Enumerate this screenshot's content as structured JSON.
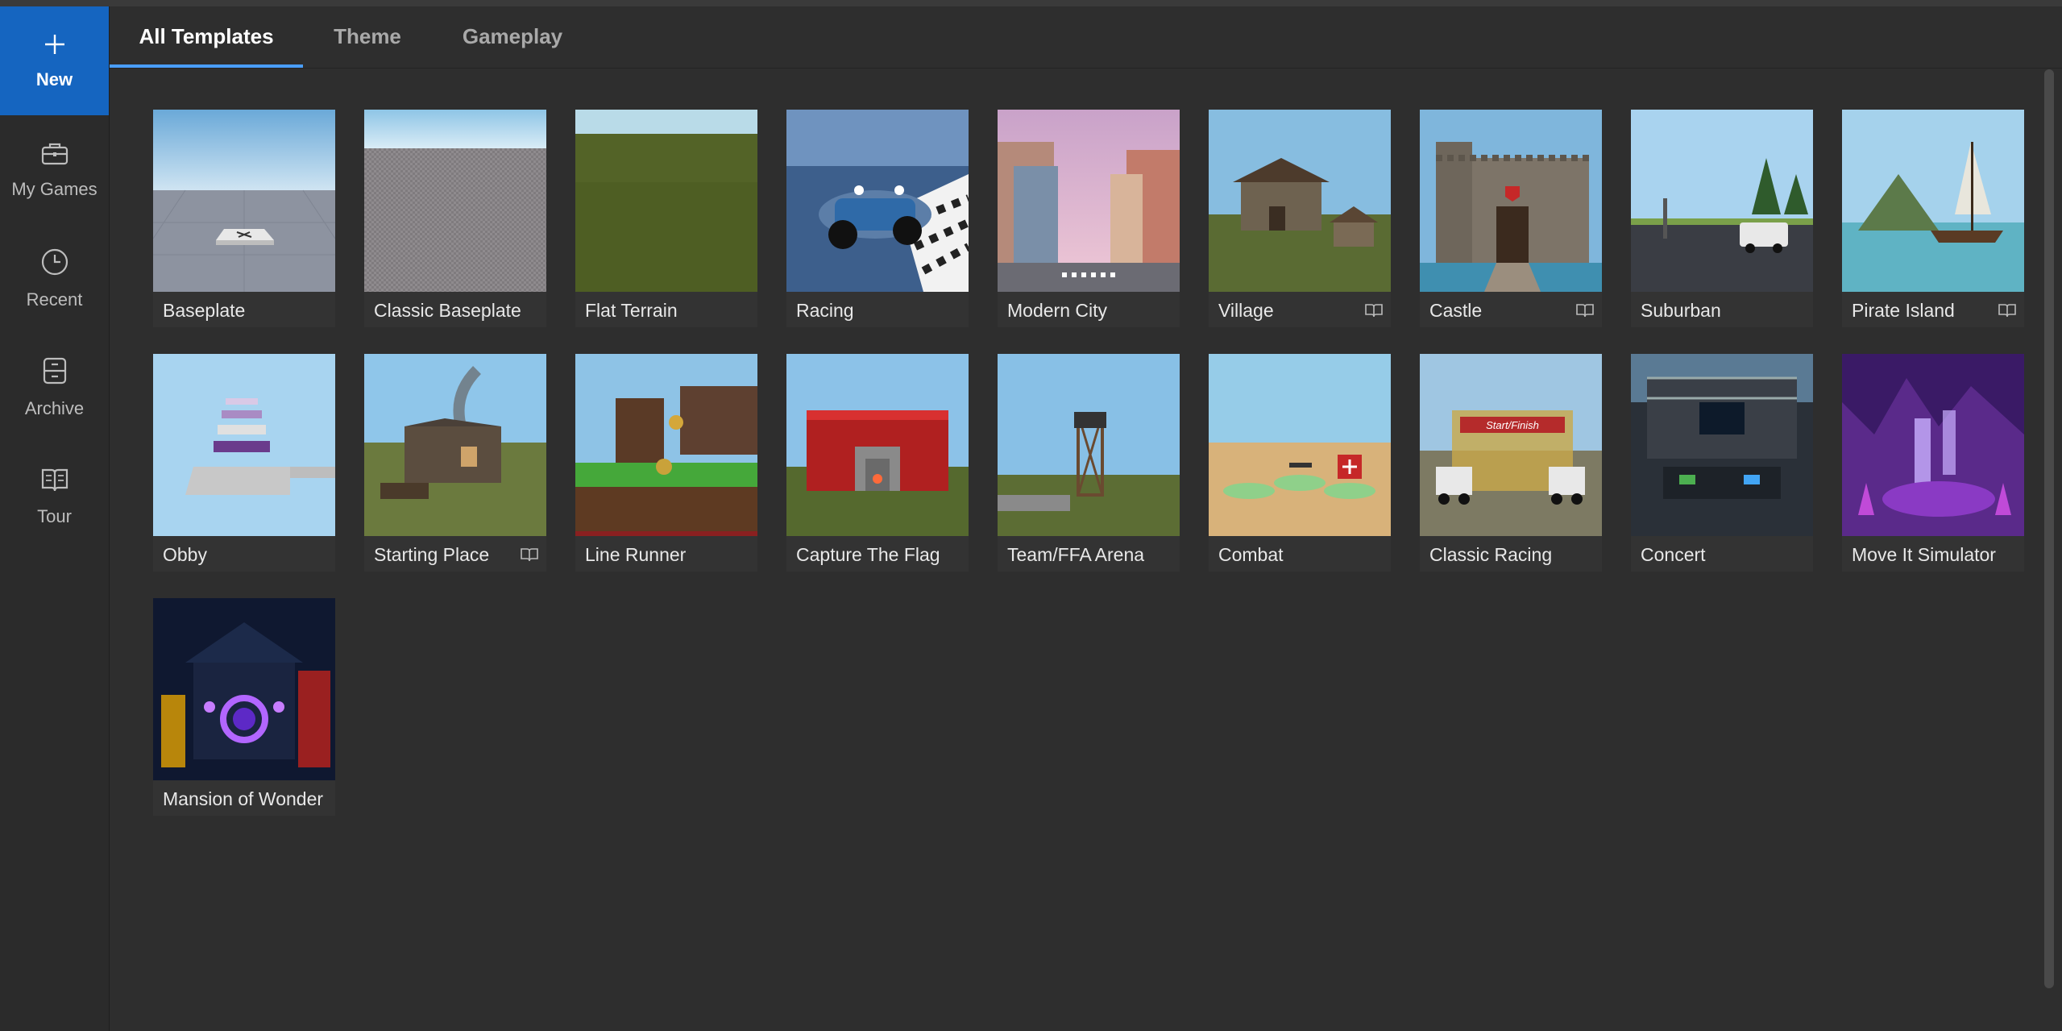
{
  "sidebar": {
    "items": [
      {
        "label": "New",
        "icon": "plus-icon",
        "active": true
      },
      {
        "label": "My Games",
        "icon": "briefcase-icon",
        "active": false
      },
      {
        "label": "Recent",
        "icon": "clock-icon",
        "active": false
      },
      {
        "label": "Archive",
        "icon": "archive-icon",
        "active": false
      },
      {
        "label": "Tour",
        "icon": "book-icon",
        "active": false
      }
    ]
  },
  "tabs": [
    {
      "label": "All Templates",
      "active": true
    },
    {
      "label": "Theme",
      "active": false
    },
    {
      "label": "Gameplay",
      "active": false
    }
  ],
  "templates": [
    {
      "name": "Baseplate",
      "tutorial": false
    },
    {
      "name": "Classic Baseplate",
      "tutorial": false
    },
    {
      "name": "Flat Terrain",
      "tutorial": false
    },
    {
      "name": "Racing",
      "tutorial": false
    },
    {
      "name": "Modern City",
      "tutorial": false
    },
    {
      "name": "Village",
      "tutorial": true
    },
    {
      "name": "Castle",
      "tutorial": true
    },
    {
      "name": "Suburban",
      "tutorial": false
    },
    {
      "name": "Pirate Island",
      "tutorial": true
    },
    {
      "name": "Obby",
      "tutorial": false
    },
    {
      "name": "Starting Place",
      "tutorial": true
    },
    {
      "name": "Line Runner",
      "tutorial": false
    },
    {
      "name": "Capture The Flag",
      "tutorial": false
    },
    {
      "name": "Team/FFA Arena",
      "tutorial": false
    },
    {
      "name": "Combat",
      "tutorial": false
    },
    {
      "name": "Classic Racing",
      "tutorial": false
    },
    {
      "name": "Concert",
      "tutorial": false
    },
    {
      "name": "Move It Simulator",
      "tutorial": false
    },
    {
      "name": "Mansion of Wonder",
      "tutorial": false
    }
  ],
  "thumb_texts": {
    "classic_racing_banner": "Start/Finish"
  },
  "colors": {
    "accent": "#1565c0",
    "tab_underline": "#4a9eff",
    "background": "#2e2e2e"
  }
}
